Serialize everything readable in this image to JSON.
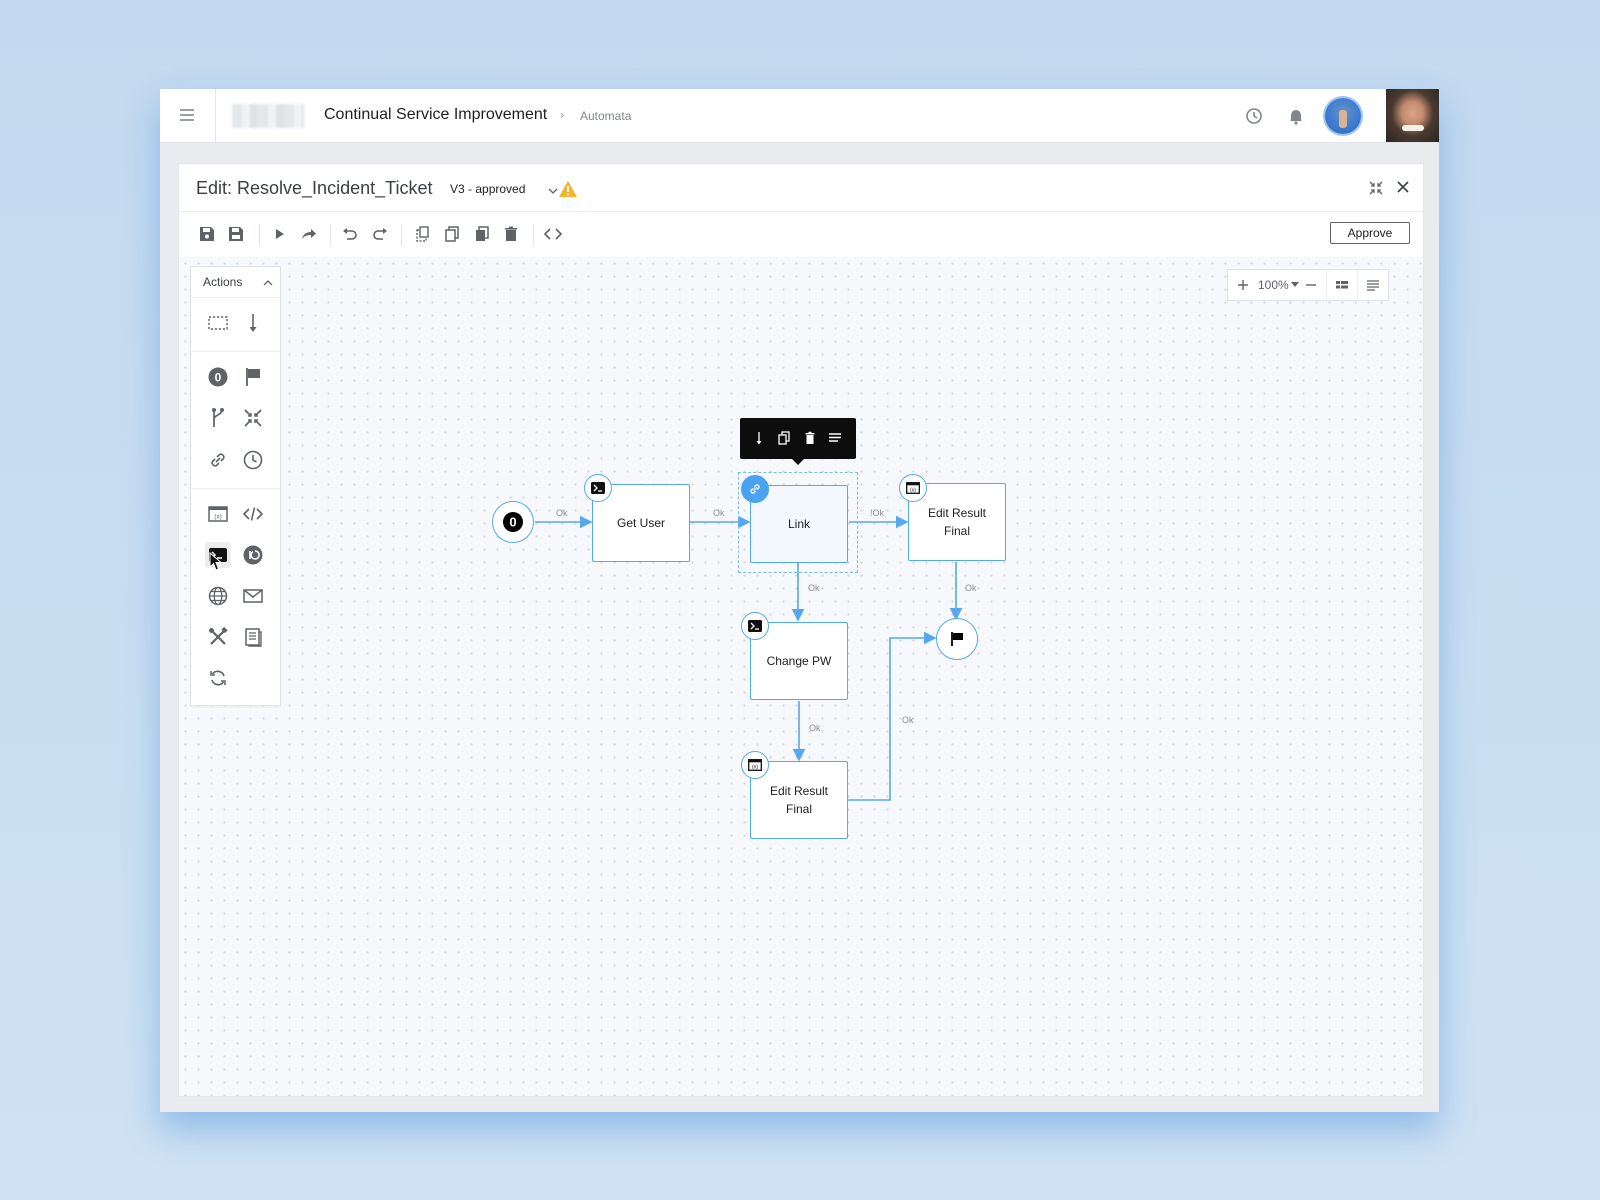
{
  "header": {
    "app_title": "Continual Service Improvement",
    "breadcrumb_sep": "›",
    "breadcrumb": "Automata"
  },
  "editor": {
    "title": "Edit: Resolve_Incident_Ticket",
    "version": "V3 - approved",
    "approve_label": "Approve"
  },
  "palette": {
    "title": "Actions"
  },
  "zoom": {
    "value": "100%"
  },
  "flow": {
    "start_label": "0",
    "nodes": {
      "get_user": "Get User",
      "link": "Link",
      "edit_result_top_line1": "Edit Result",
      "edit_result_top_line2": "Final",
      "change_pw": "Change PW",
      "edit_result_bottom_line1": "Edit Result",
      "edit_result_bottom_line2": "Final"
    },
    "edge_labels": {
      "start_to_get_user": "Ok",
      "get_user_to_link": "Ok",
      "link_to_edit_result": "!Ok",
      "link_to_change_pw": "Ok",
      "edit_result_to_end": "Ok",
      "change_pw_to_edit_result": "Ok",
      "edit_result_bottom_to_end": "Ok"
    }
  },
  "colors": {
    "accent": "#4aa3f0",
    "node_border": "#55a8ee",
    "warning": "#f5b32b"
  }
}
